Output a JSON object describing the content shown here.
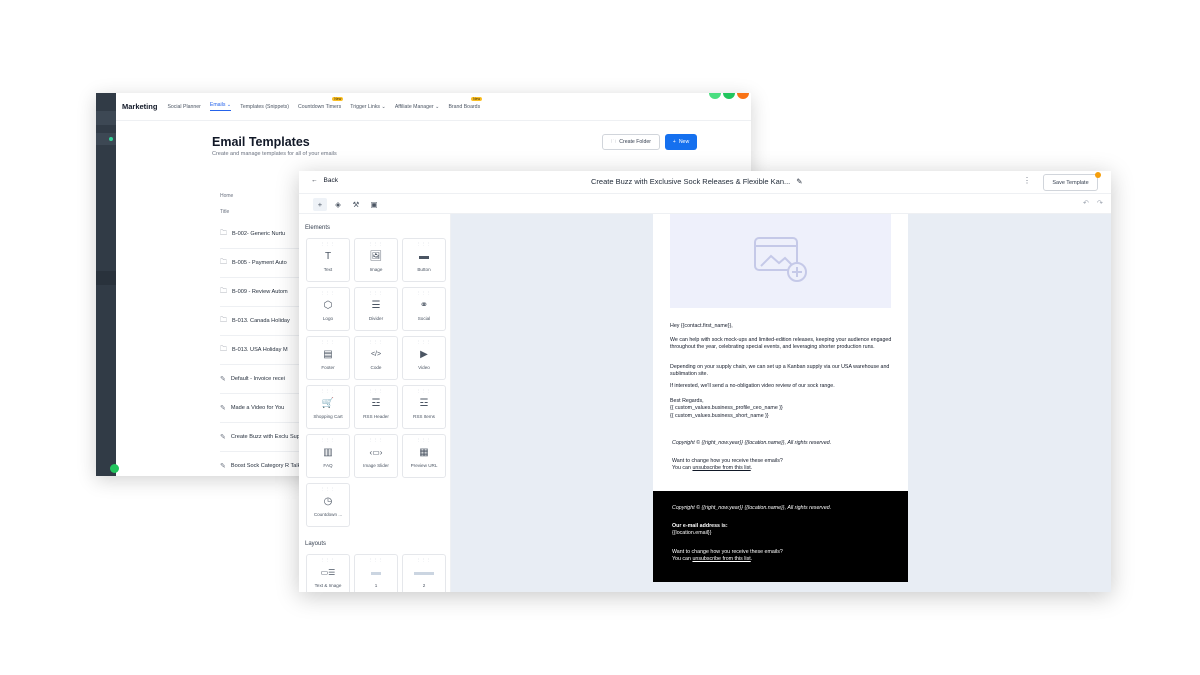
{
  "back_window": {
    "nav": {
      "brand": "Marketing",
      "items": [
        {
          "label": "Social Planner",
          "badge": ""
        },
        {
          "label": "Emails ⌄",
          "badge": ""
        },
        {
          "label": "Templates (Snippets)",
          "badge": ""
        },
        {
          "label": "Countdown Timers",
          "badge": "New"
        },
        {
          "label": "Trigger Links ⌄",
          "badge": ""
        },
        {
          "label": "Affiliate Manager ⌄",
          "badge": ""
        },
        {
          "label": "Brand Boards",
          "badge": "New"
        }
      ]
    },
    "title": "Email Templates",
    "subtitle": "Create and manage templates for all of your emails",
    "create_folder_label": "Create Folder",
    "new_label": "New",
    "breadcrumb": "Home",
    "column_title": "Title",
    "rows": [
      "B-002- Generic Nurtu",
      "B-005 - Payment Auto",
      "B-009 - Review Autom",
      "B-013. Canada Holiday",
      "B-013. USA Holiday M",
      "Default - Invoice recei",
      "Made a Video for You",
      "Create Buzz with Exclu Supply",
      "Boost Sock Category R Talk!"
    ]
  },
  "editor": {
    "back_label": "Back",
    "title": "Create Buzz with Exclusive Sock Releases & Flexible Kan...",
    "save_label": "Save Template",
    "sections": {
      "elements": "Elements",
      "layouts": "Layouts"
    },
    "elements": [
      {
        "label": "Text",
        "icon": "T"
      },
      {
        "label": "Image",
        "icon": "🖼"
      },
      {
        "label": "Button",
        "icon": "▬"
      },
      {
        "label": "Logo",
        "icon": "⬡"
      },
      {
        "label": "Divider",
        "icon": "☰"
      },
      {
        "label": "Social",
        "icon": "⚭"
      },
      {
        "label": "Footer",
        "icon": "▤"
      },
      {
        "label": "Code",
        "icon": "</>"
      },
      {
        "label": "Video",
        "icon": "▶"
      },
      {
        "label": "Shopping Cart",
        "icon": "🛒"
      },
      {
        "label": "RSS Header",
        "icon": "☲"
      },
      {
        "label": "RSS Items",
        "icon": "☲"
      },
      {
        "label": "FAQ",
        "icon": "▥"
      },
      {
        "label": "Image Slider",
        "icon": "‹▭›"
      },
      {
        "label": "Preview URL",
        "icon": "▦"
      },
      {
        "label": "Countdown ...",
        "icon": "◷"
      }
    ],
    "layouts": [
      {
        "label": "Text & Image",
        "icon": "▭☰"
      },
      {
        "label": "1",
        "icon": "▬"
      },
      {
        "label": "2",
        "icon": "▬▬"
      }
    ]
  },
  "email": {
    "greeting": "Hey {{contact.first_name}},",
    "p1": "We can help with sock mock-ups and limited-edition releases, keeping your audience engaged throughout the year, celebrating special events, and leveraging shorter production runs.",
    "p2": "Depending on your supply chain, we can set up a Kanban supply via our USA warehouse and sublimation site.",
    "p3": "If interested, we'll send a no-obligation video review of our sock range.",
    "regards": "Best Regards,",
    "sig1": "{{ custom_values.business_profile_ceo_name }}",
    "sig2": "{{ custom_values.business_short_name }}",
    "copyright": "Copyright © {{right_now.year}}  {{location.name}}, All rights reserved.",
    "change_q": "Want to change how you receive these emails?",
    "you_can": "You can",
    "unsubscribe": "unsubscribe from this list",
    "footer": {
      "copyright": "Copyright © {{right_now.year}}  {{location.name}}, All rights reserved.",
      "address_label": "Our e-mail address is:",
      "address": "{{location.email}}",
      "change_q": "Want to change how you receive these emails?",
      "you_can": "You can",
      "unsubscribe": "unsubscribe from this list"
    }
  },
  "colors": {
    "primary": "#1570ef",
    "rail": "#313b46",
    "canvas": "#e8edf4",
    "footer_bg": "#000000"
  }
}
